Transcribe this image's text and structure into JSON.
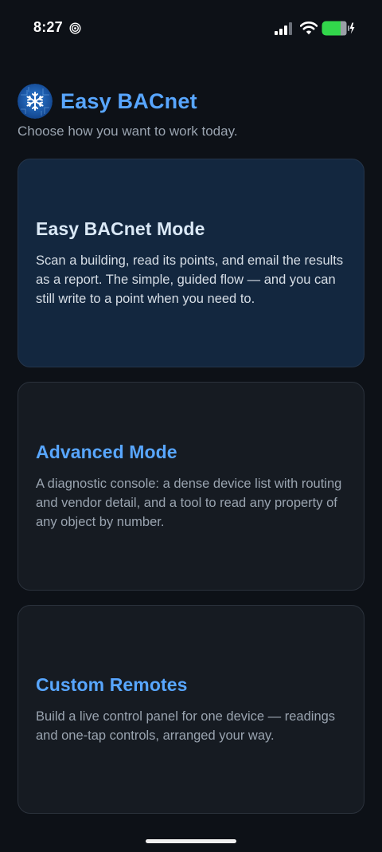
{
  "status_bar": {
    "time": "8:27",
    "icons": [
      "focus-icon",
      "cellular-signal-icon",
      "wifi-icon",
      "battery-charging-icon"
    ],
    "battery_color": "#32d74b"
  },
  "header": {
    "title": "Easy BACnet",
    "subtitle": "Choose how you want to work today.",
    "logo_icon": "snowflake-icon",
    "accent_color": "#58a6ff"
  },
  "modes": [
    {
      "title": "Easy BACnet Mode",
      "description": "Scan a building, read its points, and email the results as a report. The simple, guided flow — and you can still write to a point when you need to.",
      "selected": true
    },
    {
      "title": "Advanced Mode",
      "description": "A diagnostic console: a dense device list with routing and vendor detail, and a tool to read any property of any object by number.",
      "selected": false
    },
    {
      "title": "Custom Remotes",
      "description": "Build a live control panel for one device — readings and one-tap controls, arranged your way.",
      "selected": false
    }
  ]
}
